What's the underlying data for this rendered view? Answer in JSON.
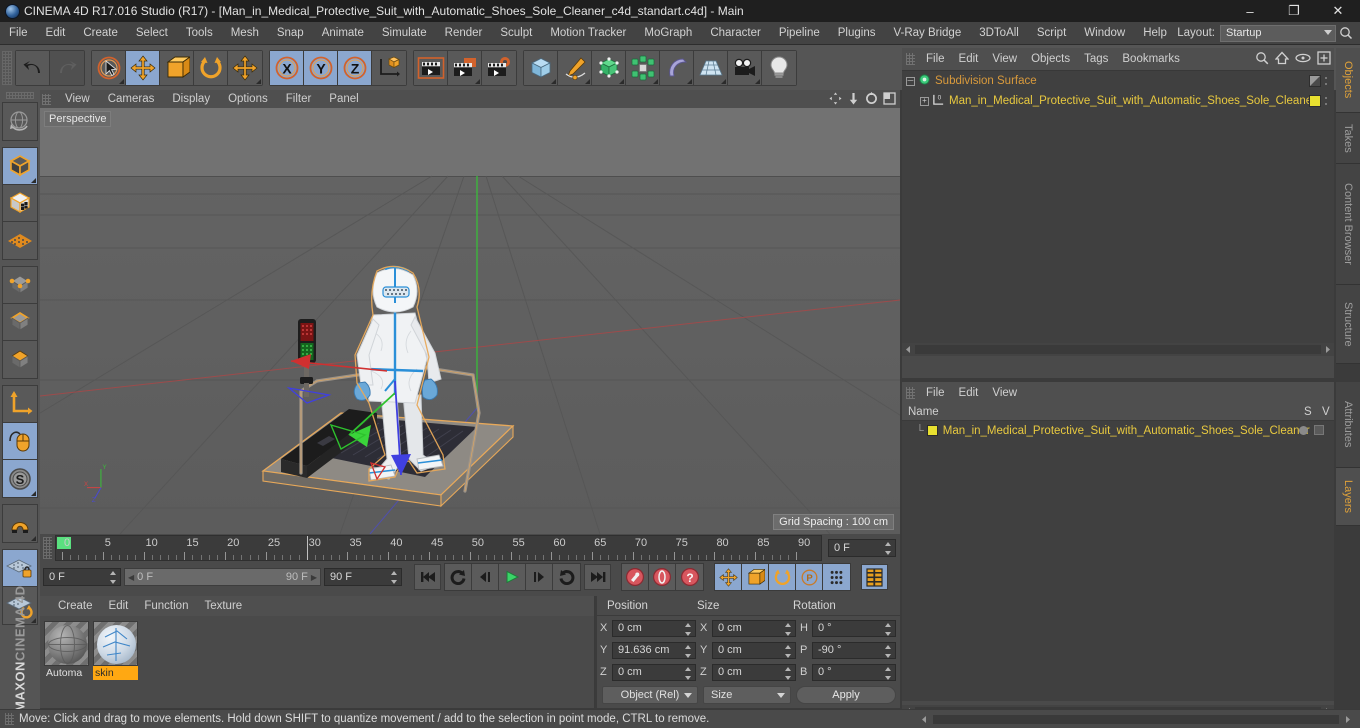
{
  "titlebar": {
    "app_icon": "c4d-orb-icon",
    "title": "CINEMA 4D R17.016 Studio (R17) - [Man_in_Medical_Protective_Suit_with_Automatic_Shoes_Sole_Cleaner_c4d_standart.c4d] - Main",
    "minimize": "–",
    "maximize": "❐",
    "close": "✕"
  },
  "menubar": {
    "items": [
      {
        "label": "File"
      },
      {
        "label": "Edit"
      },
      {
        "label": "Create"
      },
      {
        "label": "Select"
      },
      {
        "label": "Tools"
      },
      {
        "label": "Mesh"
      },
      {
        "label": "Snap"
      },
      {
        "label": "Animate"
      },
      {
        "label": "Simulate"
      },
      {
        "label": "Render"
      },
      {
        "label": "Sculpt"
      },
      {
        "label": "Motion Tracker"
      },
      {
        "label": "MoGraph"
      },
      {
        "label": "Character"
      },
      {
        "label": "Pipeline"
      },
      {
        "label": "Plugins"
      },
      {
        "label": "V-Ray Bridge"
      },
      {
        "label": "3DToAll"
      },
      {
        "label": "Script"
      },
      {
        "label": "Window"
      },
      {
        "label": "Help"
      }
    ],
    "layout_label": "Layout:",
    "layout_value": "Startup"
  },
  "toolbar": {
    "groups": [
      {
        "name": "undo-redo",
        "buttons": [
          {
            "name": "undo-button",
            "icon": "undo-icon",
            "state": "normal"
          },
          {
            "name": "redo-button",
            "icon": "redo-icon",
            "state": "disabled"
          }
        ]
      },
      {
        "name": "transform-tools",
        "buttons": [
          {
            "name": "select-tool",
            "icon": "live-selection-icon",
            "state": "normal"
          },
          {
            "name": "move-tool",
            "icon": "move-icon",
            "state": "active"
          },
          {
            "name": "scale-tool",
            "icon": "scale-icon",
            "state": "normal"
          },
          {
            "name": "rotate-tool",
            "icon": "rotate-icon",
            "state": "normal"
          },
          {
            "name": "move-duplicate-tool",
            "icon": "move-icon",
            "state": "normal"
          }
        ]
      },
      {
        "name": "axis-locks",
        "buttons": [
          {
            "name": "lock-x-axis",
            "icon": "x-axis-icon",
            "state": "active"
          },
          {
            "name": "lock-y-axis",
            "icon": "y-axis-icon",
            "state": "active"
          },
          {
            "name": "lock-z-axis",
            "icon": "z-axis-icon",
            "state": "active"
          },
          {
            "name": "world-object-coordinate",
            "icon": "world-axis-icon",
            "state": "normal"
          }
        ]
      },
      {
        "name": "render-tools",
        "buttons": [
          {
            "name": "render-view",
            "icon": "render-view-icon",
            "state": "normal"
          },
          {
            "name": "render-region",
            "icon": "render-region-icon",
            "state": "normal"
          },
          {
            "name": "render-settings",
            "icon": "render-settings-icon",
            "state": "normal"
          }
        ]
      },
      {
        "name": "create-objects",
        "buttons": [
          {
            "name": "add-cube-object",
            "icon": "cube-icon",
            "state": "normal"
          },
          {
            "name": "add-spline",
            "icon": "pen-spline-icon",
            "state": "normal"
          },
          {
            "name": "add-generator",
            "icon": "generator-icon",
            "state": "normal"
          },
          {
            "name": "add-deformer",
            "icon": "deformer-icon",
            "state": "normal"
          },
          {
            "name": "add-scene-object",
            "icon": "bend-icon",
            "state": "normal"
          },
          {
            "name": "add-environment",
            "icon": "floor-icon",
            "state": "normal"
          },
          {
            "name": "add-camera",
            "icon": "camera-icon",
            "state": "normal"
          },
          {
            "name": "add-light",
            "icon": "light-bulb-icon",
            "state": "normal"
          }
        ]
      }
    ]
  },
  "left_toolbar": {
    "buttons": [
      {
        "name": "undo-view-button",
        "icon": "globe-undo-icon",
        "state": "normal"
      },
      {
        "name": "model-mode",
        "icon": "model-cube-icon",
        "state": "active"
      },
      {
        "name": "texture-mode",
        "icon": "texture-cube-icon",
        "state": "normal"
      },
      {
        "name": "workplane-mode",
        "icon": "workplane-icon",
        "state": "normal"
      },
      {
        "name": "points-mode",
        "icon": "points-cube-icon",
        "state": "normal"
      },
      {
        "name": "edges-mode",
        "icon": "edges-cube-icon",
        "state": "normal"
      },
      {
        "name": "polygons-mode",
        "icon": "polygons-cube-icon",
        "state": "normal"
      },
      {
        "name": "axis-modify-mode",
        "icon": "axis-icon",
        "state": "normal"
      },
      {
        "name": "viewport-solo-mode",
        "icon": "mouse-icon",
        "state": "active"
      },
      {
        "name": "snap-enable",
        "icon": "snap-s-icon",
        "state": "active"
      },
      {
        "name": "magnet-tool",
        "icon": "magnet-icon",
        "state": "normal"
      },
      {
        "name": "workplane-lock",
        "icon": "workplane-lock-icon",
        "state": "active"
      },
      {
        "name": "workplane-reset",
        "icon": "workplane-reset-icon",
        "state": "normal"
      }
    ],
    "brand_top": "MAXON",
    "brand_bottom": "CINEMA 4D"
  },
  "viewport": {
    "menu": [
      {
        "label": "View"
      },
      {
        "label": "Cameras"
      },
      {
        "label": "Display"
      },
      {
        "label": "Options"
      },
      {
        "label": "Filter"
      },
      {
        "label": "Panel"
      }
    ],
    "corner_icons": [
      {
        "name": "viewport-move-icon"
      },
      {
        "name": "viewport-scale-icon"
      },
      {
        "name": "viewport-rotate-icon"
      },
      {
        "name": "viewport-maximize-icon"
      }
    ],
    "label": "Perspective",
    "grid_spacing": "Grid Spacing : 100 cm",
    "axis_gizmo": {
      "x": "X",
      "y": "Y",
      "z": "Z"
    },
    "colors": {
      "x_axis": "#cc4444",
      "y_axis": "#3bbb3b",
      "z_axis": "#4a4ad0",
      "selection_outline": "#e8a95a",
      "background_top": "#727272",
      "background_bottom": "#5c5c5c"
    }
  },
  "timeline": {
    "ruler": {
      "ticks": [
        0,
        5,
        10,
        15,
        20,
        25,
        30,
        35,
        40,
        45,
        50,
        55,
        60,
        65,
        70,
        75,
        80,
        85,
        90
      ],
      "min": 0,
      "max": 90,
      "playhead_frame": 30
    },
    "current_frame_field": "0 F",
    "start_frame_field": "0 F",
    "range_start": "0 F",
    "range_end": "90 F",
    "end_frame_field": "90 F",
    "transport": [
      {
        "name": "go-to-start-button",
        "icon": "skip-start-icon"
      },
      {
        "name": "play-backwards-loop-button",
        "icon": "rewind-loop-icon"
      },
      {
        "name": "step-back-button",
        "icon": "step-back-icon"
      },
      {
        "name": "play-button",
        "icon": "play-icon"
      },
      {
        "name": "step-forward-button",
        "icon": "step-forward-icon"
      },
      {
        "name": "play-forward-loop-button",
        "icon": "forward-loop-icon"
      },
      {
        "name": "go-to-end-button",
        "icon": "skip-end-icon"
      }
    ],
    "record_tools": [
      {
        "name": "record-keyframe-button",
        "icon": "record-key-icon"
      },
      {
        "name": "autokeying-button",
        "icon": "autokey-icon"
      },
      {
        "name": "keyframe-selection-button",
        "icon": "key-question-icon"
      }
    ],
    "key_filters": [
      {
        "name": "record-position-button",
        "icon": "move-icon",
        "state": "active"
      },
      {
        "name": "record-scale-button",
        "icon": "scale-icon",
        "state": "active"
      },
      {
        "name": "record-rotation-button",
        "icon": "rotate-icon",
        "state": "active"
      },
      {
        "name": "record-param-button",
        "icon": "param-p-icon",
        "state": "active"
      },
      {
        "name": "record-pla-button",
        "icon": "pla-dots-icon",
        "state": "active"
      }
    ],
    "extra": [
      {
        "name": "timeline-filmstrip-button",
        "icon": "filmstrip-icon",
        "state": "active"
      }
    ]
  },
  "material_manager": {
    "menu": [
      {
        "label": "Create"
      },
      {
        "label": "Edit"
      },
      {
        "label": "Function"
      },
      {
        "label": "Texture"
      }
    ],
    "materials": [
      {
        "name": "Automa",
        "full_name": "Automatic",
        "selected": false,
        "color": "#7d7d7d"
      },
      {
        "name": "skin",
        "full_name": "skin",
        "selected": true,
        "color": "#c9d6e4"
      }
    ]
  },
  "coordinates": {
    "headers": {
      "position": "Position",
      "size": "Size",
      "rotation": "Rotation"
    },
    "rows": [
      {
        "pos_axis": "X",
        "pos_value": "0 cm",
        "size_axis": "X",
        "size_value": "0 cm",
        "rot_axis": "H",
        "rot_value": "0 °"
      },
      {
        "pos_axis": "Y",
        "pos_value": "91.636 cm",
        "size_axis": "Y",
        "size_value": "0 cm",
        "rot_axis": "P",
        "rot_value": "-90 °"
      },
      {
        "pos_axis": "Z",
        "pos_value": "0 cm",
        "size_axis": "Z",
        "size_value": "0 cm",
        "rot_axis": "B",
        "rot_value": "0 °"
      }
    ],
    "mode_dropdown": "Object (Rel)",
    "size_dropdown": "Size",
    "apply_button": "Apply"
  },
  "object_manager": {
    "menu": [
      {
        "label": "File"
      },
      {
        "label": "Edit"
      },
      {
        "label": "View"
      },
      {
        "label": "Objects"
      },
      {
        "label": "Tags"
      },
      {
        "label": "Bookmarks"
      }
    ],
    "right_icons": [
      {
        "name": "search-icon"
      },
      {
        "name": "home-icon"
      },
      {
        "name": "eye-icon"
      },
      {
        "name": "new-layer-icon"
      }
    ],
    "rows": [
      {
        "label": "Subdivision Surface",
        "icon": "subdivision-surface-icon",
        "color": "orange",
        "tag_color": "#8c8c8c"
      },
      {
        "label": "Man_in_Medical_Protective_Suit_with_Automatic_Shoes_Sole_Cleaner",
        "icon": "polygon-object-icon",
        "color": "yellow",
        "tag_color": "#e8e030"
      }
    ],
    "tabs": [
      {
        "label": "Objects",
        "active": true
      },
      {
        "label": "Takes",
        "active": false
      },
      {
        "label": "Content Browser",
        "active": false
      },
      {
        "label": "Structure",
        "active": false
      }
    ]
  },
  "layer_manager": {
    "menu": [
      {
        "label": "File"
      },
      {
        "label": "Edit"
      },
      {
        "label": "View"
      }
    ],
    "columns": [
      "Name",
      "S",
      "V"
    ],
    "rows": [
      {
        "label": "Man_in_Medical_Protective_Suit_with_Automatic_Shoes_Sole_Cleaner",
        "swatch": "#e8e030"
      }
    ],
    "tabs": [
      {
        "label": "Attributes",
        "active": false
      },
      {
        "label": "Layers",
        "active": true
      }
    ]
  },
  "statusbar": {
    "message": "Move: Click and drag to move elements. Hold down SHIFT to quantize movement / add to the selection in point mode, CTRL to remove."
  }
}
